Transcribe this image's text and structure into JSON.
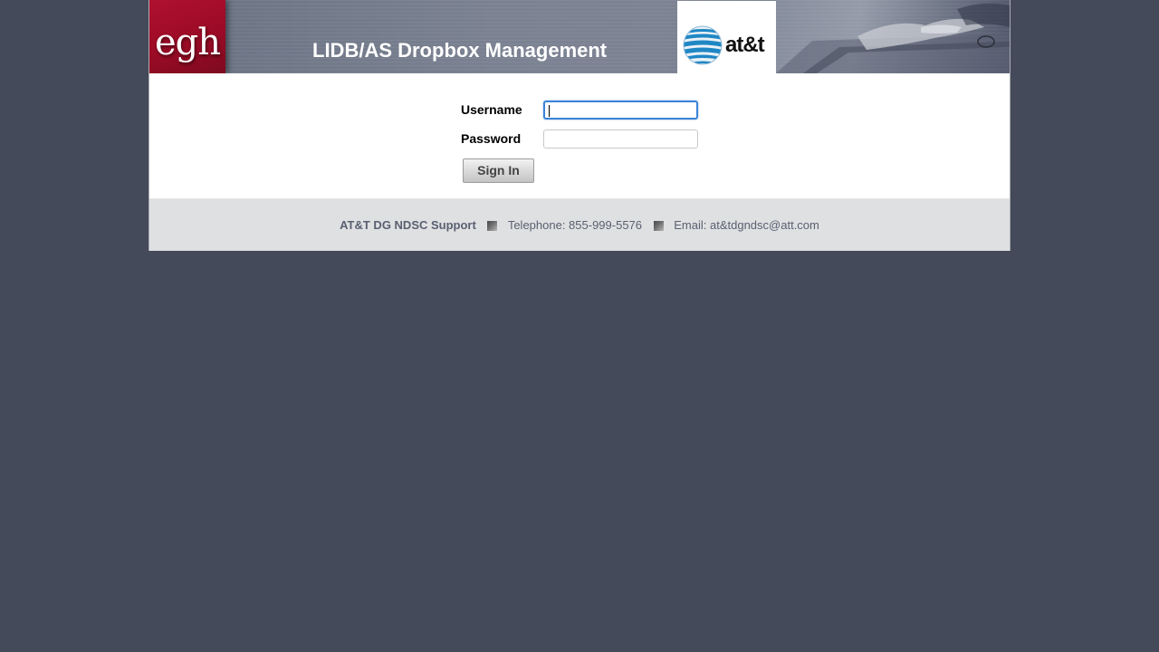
{
  "header": {
    "brand_logo_text": "egh",
    "title": "LIDB/AS Dropbox Management",
    "partner_logo_text": "at&t"
  },
  "login_form": {
    "username_label": "Username",
    "username_value": "",
    "password_label": "Password",
    "password_value": "",
    "submit_label": "Sign In"
  },
  "footer": {
    "support_name": "AT&T DG NDSC Support",
    "telephone": "Telephone: 855-999-5576",
    "email": "Email: at&tdgndsc@att.com"
  },
  "colors": {
    "page_background": "#444a59",
    "brand_red": "#9b0b26",
    "focus_blue": "#3b83d6",
    "footer_background": "#dfe0e2",
    "footer_text": "#5a6070"
  },
  "icons": {
    "separator": "square-bullet-icon",
    "partner_globe": "att-globe-icon"
  }
}
